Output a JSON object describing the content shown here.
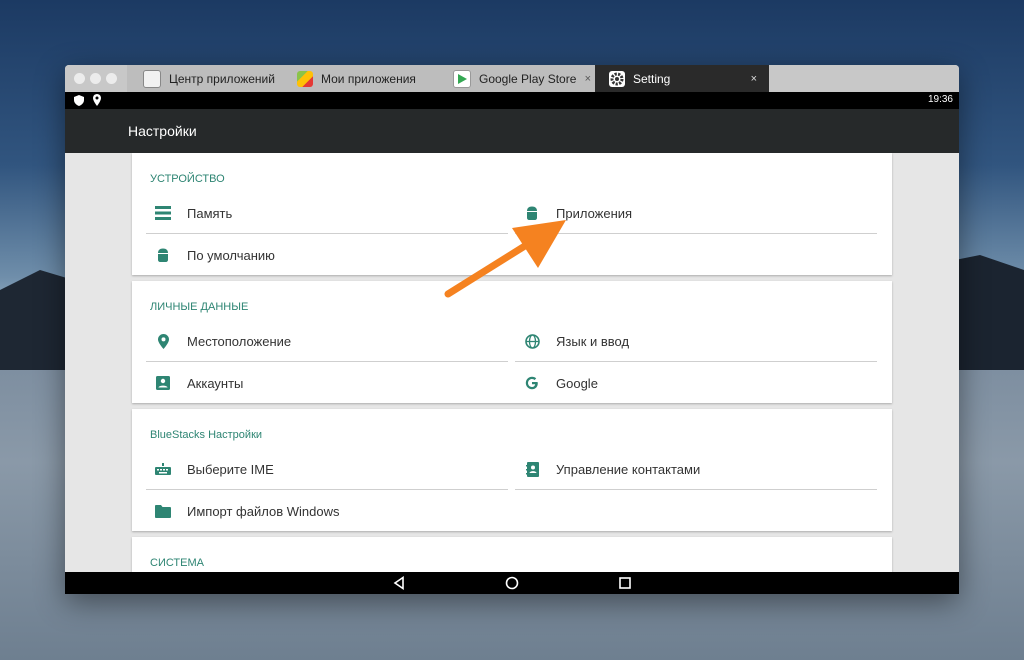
{
  "tabs": [
    {
      "label": "Центр приложений"
    },
    {
      "label": "Мои приложения"
    },
    {
      "label": "Google Play Store",
      "close": "×"
    },
    {
      "label": "Setting",
      "close": "×"
    }
  ],
  "status": {
    "time": "19:36"
  },
  "appbar": {
    "title": "Настройки"
  },
  "sections": [
    {
      "header": "УСТРОЙСТВО",
      "items": [
        {
          "label": "Память",
          "icon": "storage-icon"
        },
        {
          "label": "Приложения",
          "icon": "android-icon"
        },
        {
          "label": "По умолчанию",
          "icon": "android-icon"
        }
      ]
    },
    {
      "header": "ЛИЧНЫЕ ДАННЫЕ",
      "items": [
        {
          "label": "Местоположение",
          "icon": "location-pin-icon"
        },
        {
          "label": "Язык и ввод",
          "icon": "globe-icon"
        },
        {
          "label": "Аккаунты",
          "icon": "account-box-icon"
        },
        {
          "label": "Google",
          "icon": "google-g-icon"
        }
      ]
    },
    {
      "header": "BlueStacks Настройки",
      "items": [
        {
          "label": "Выберите IME",
          "icon": "keyboard-icon"
        },
        {
          "label": "Управление контактами",
          "icon": "contacts-icon"
        },
        {
          "label": "Импорт файлов Windows",
          "icon": "folder-icon"
        }
      ]
    },
    {
      "header": "СИСТЕМА",
      "items": []
    }
  ],
  "colors": {
    "accent": "#2e8573",
    "appbar": "#26292a",
    "arrow": "#f58220"
  }
}
